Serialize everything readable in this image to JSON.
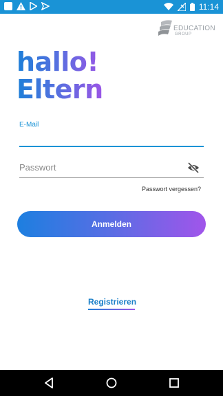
{
  "status_bar": {
    "time": "11:14",
    "icons": [
      "app-square-icon",
      "warning-icon",
      "play-store-icon",
      "send-icon",
      "wifi-icon",
      "signal-off-icon",
      "battery-icon"
    ]
  },
  "logo": {
    "line1": "EDUCATION",
    "line2": "GROUP"
  },
  "greeting": {
    "line1": "hallo!",
    "line2": "Eltern"
  },
  "form": {
    "email_label": "E-Mail",
    "password_placeholder": "Passwort",
    "forgot_link": "Passwort vergessen?",
    "login_button": "Anmelden",
    "register_link": "Registrieren"
  },
  "colors": {
    "status_bar": "#1a93d6",
    "accent_blue": "#1a93d6",
    "gradient_start": "#1d7fd8",
    "gradient_end": "#9b55e6"
  },
  "nav_bar": {
    "icons": [
      "back-icon",
      "home-icon",
      "recents-icon"
    ]
  }
}
